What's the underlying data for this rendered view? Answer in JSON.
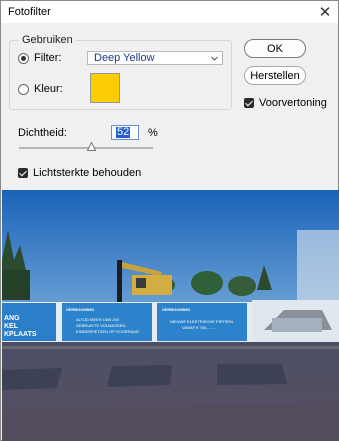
{
  "window": {
    "title": "Fotofilter"
  },
  "group": {
    "legend": "Gebruiken",
    "filter_label": "Filter:",
    "filter_value": "Deep Yellow",
    "color_label": "Kleur:",
    "selected": "filter",
    "color_swatch": "#fccc05"
  },
  "buttons": {
    "ok": "OK",
    "reset": "Herstellen"
  },
  "preview_check": {
    "label": "Voorvertoning",
    "checked": true
  },
  "density": {
    "label": "Dichtheid:",
    "value": "52",
    "unit": "%"
  },
  "luminosity_check": {
    "label": "Lichtsterkte behouden",
    "checked": true
  },
  "preview_image": {
    "banners": {
      "left": [
        "ANG",
        "KEL",
        "KPLAATS"
      ],
      "center_left": [
        "VERBOUWING",
        "ALTIJD MEER DAN 200",
        "GEBRUIKTE VOLWASSEN...",
        "KINDERFIETSEN OP VOORRAAD"
      ],
      "center_right": [
        "VERBOUWING",
        "NIEUWE ELEKTRISCHE FIETSEN",
        "VANAF € 750,- ......"
      ]
    }
  }
}
